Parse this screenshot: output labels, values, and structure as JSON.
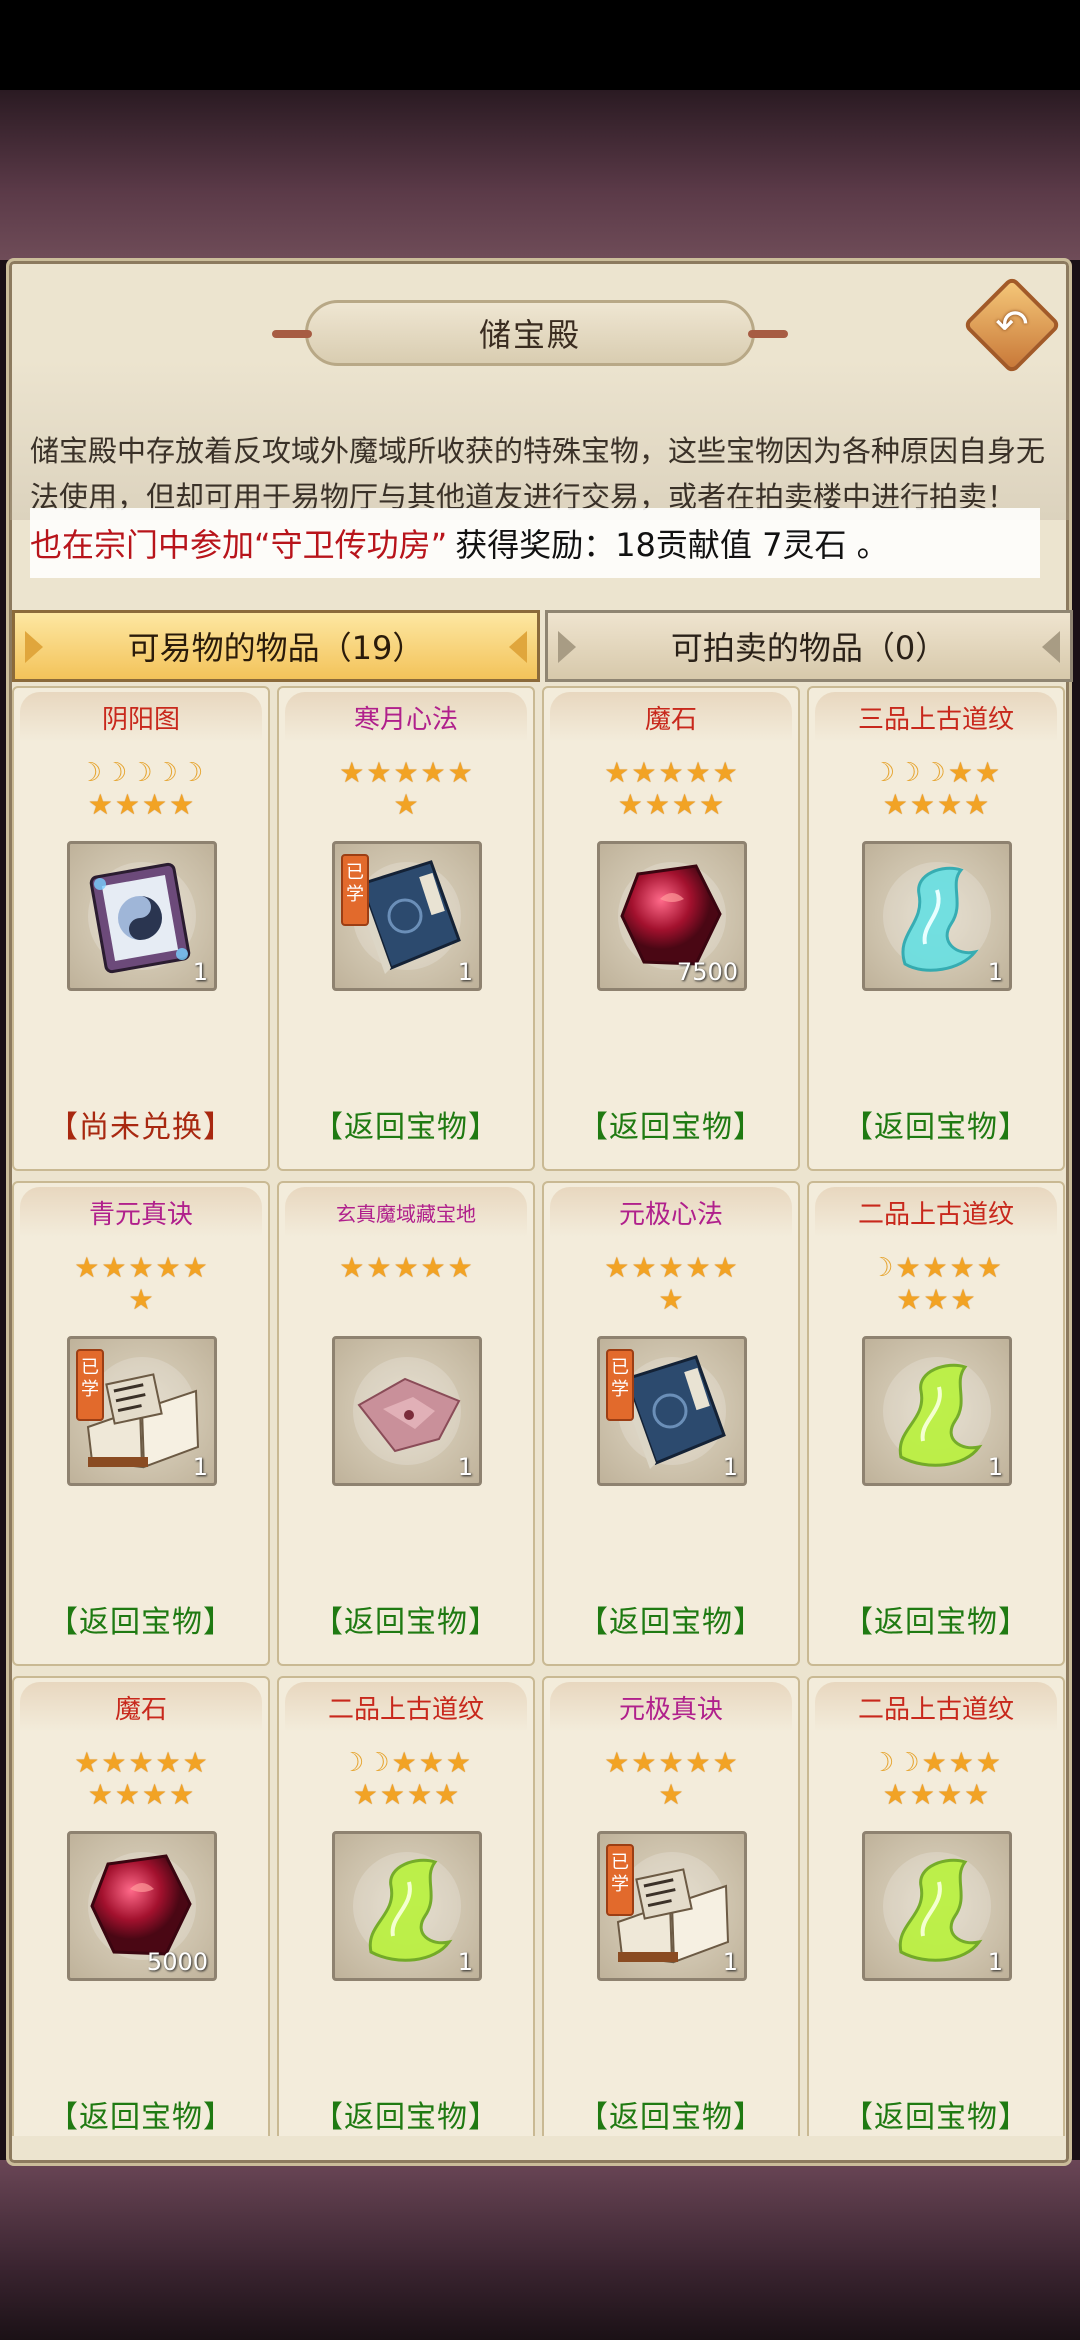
{
  "title": "储宝殿",
  "back_icon": "back-arrow-icon",
  "description": "储宝殿中存放着反攻域外魔域所收获的特殊宝物，这些宝物因为各种原因自身无法使用，但却可用于易物厅与其他道友进行交易，或者在拍卖楼中进行拍卖！",
  "notice": {
    "prefix": "也在宗门中参加",
    "highlight": "“守卫传功房”",
    "suffix": "获得奖励：18贡献值 7灵石 。"
  },
  "tabs": {
    "tradable": "可易物的物品（19）",
    "auction": "可拍卖的物品（0）"
  },
  "items": [
    {
      "name": "阴阳图",
      "name_color": "#c8281c",
      "moons": 5,
      "stars": 4,
      "qty": "1",
      "learned": false,
      "action": "【尚未兑换】",
      "action_type": "red",
      "icon": "yin-yang-scroll-icon"
    },
    {
      "name": "寒月心法",
      "name_color": "#b0208c",
      "moons": 0,
      "stars": 6,
      "qty": "1",
      "learned": true,
      "action": "【返回宝物】",
      "action_type": "green",
      "icon": "blue-manual-book-icon"
    },
    {
      "name": "魔石",
      "name_color": "#c8281c",
      "moons": 0,
      "stars": 9,
      "qty": "7500",
      "learned": false,
      "action": "【返回宝物】",
      "action_type": "green",
      "icon": "red-demon-stone-icon"
    },
    {
      "name": "三品上古道纹",
      "name_color": "#c8281c",
      "moons": 3,
      "stars": 6,
      "qty": "1",
      "learned": false,
      "action": "【返回宝物】",
      "action_type": "green",
      "icon": "cyan-dao-pattern-icon"
    },
    {
      "name": "青元真诀",
      "name_color": "#b0208c",
      "moons": 0,
      "stars": 6,
      "qty": "1",
      "learned": true,
      "action": "【返回宝物】",
      "action_type": "green",
      "icon": "open-book-icon"
    },
    {
      "name": "玄真魔域藏宝地",
      "name_color": "#b0208c",
      "moons": 0,
      "stars": 5,
      "qty": "1",
      "learned": false,
      "action": "【返回宝物】",
      "action_type": "green",
      "icon": "treasure-map-cloth-icon"
    },
    {
      "name": "元极心法",
      "name_color": "#b0208c",
      "moons": 0,
      "stars": 6,
      "qty": "1",
      "learned": true,
      "action": "【返回宝物】",
      "action_type": "green",
      "icon": "blue-manual-book-icon"
    },
    {
      "name": "二品上古道纹",
      "name_color": "#c8281c",
      "moons": 1,
      "stars": 7,
      "qty": "1",
      "learned": false,
      "action": "【返回宝物】",
      "action_type": "green",
      "icon": "green-dao-pattern-icon"
    },
    {
      "name": "魔石",
      "name_color": "#c8281c",
      "moons": 0,
      "stars": 9,
      "qty": "5000",
      "learned": false,
      "action": "【返回宝物】",
      "action_type": "green",
      "icon": "red-demon-stone-icon"
    },
    {
      "name": "二品上古道纹",
      "name_color": "#c8281c",
      "moons": 2,
      "stars": 7,
      "qty": "1",
      "learned": false,
      "action": "【返回宝物】",
      "action_type": "green",
      "icon": "green-dao-pattern-icon"
    },
    {
      "name": "元极真诀",
      "name_color": "#b0208c",
      "moons": 0,
      "stars": 6,
      "qty": "1",
      "learned": true,
      "action": "【返回宝物】",
      "action_type": "green",
      "icon": "open-book-icon"
    },
    {
      "name": "二品上古道纹",
      "name_color": "#c8281c",
      "moons": 2,
      "stars": 7,
      "qty": "1",
      "learned": false,
      "action": "【返回宝物】",
      "action_type": "green",
      "icon": "green-dao-pattern-icon"
    }
  ],
  "learned_badge": "已学"
}
